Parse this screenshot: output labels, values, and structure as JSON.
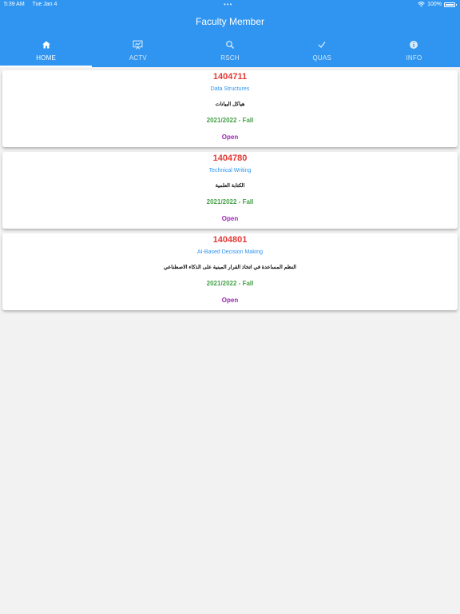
{
  "status": {
    "time": "5:39 AM",
    "date": "Tue Jan 4",
    "battery": "100%"
  },
  "header": {
    "title": "Faculty Member"
  },
  "tabs": [
    {
      "label": "HOME",
      "icon": "home-icon",
      "active": true
    },
    {
      "label": "ACTV",
      "icon": "presentation-icon",
      "active": false
    },
    {
      "label": "RSCH",
      "icon": "search-icon",
      "active": false
    },
    {
      "label": "QUAS",
      "icon": "check-icon",
      "active": false
    },
    {
      "label": "INFO",
      "icon": "info-icon",
      "active": false
    }
  ],
  "courses": [
    {
      "code": "1404711",
      "name": "Data Structures",
      "arabic": "هياكل البيانات",
      "semester": "2021/2022 - Fall",
      "action": "Open"
    },
    {
      "code": "1404780",
      "name": "Technical Writing",
      "arabic": "الكتابة العلمية",
      "semester": "2021/2022 - Fall",
      "action": "Open"
    },
    {
      "code": "1404801",
      "name": "AI-Based Decision Making",
      "arabic": "النظم المساعدة في اتخاذ القرار المبنية على الذكاء الاصطناعي",
      "semester": "2021/2022 - Fall",
      "action": "Open"
    }
  ],
  "colors": {
    "header": "#2f95f0",
    "code": "#e53935",
    "name": "#2f95f0",
    "semester": "#43a047",
    "action": "#9c27b0"
  }
}
